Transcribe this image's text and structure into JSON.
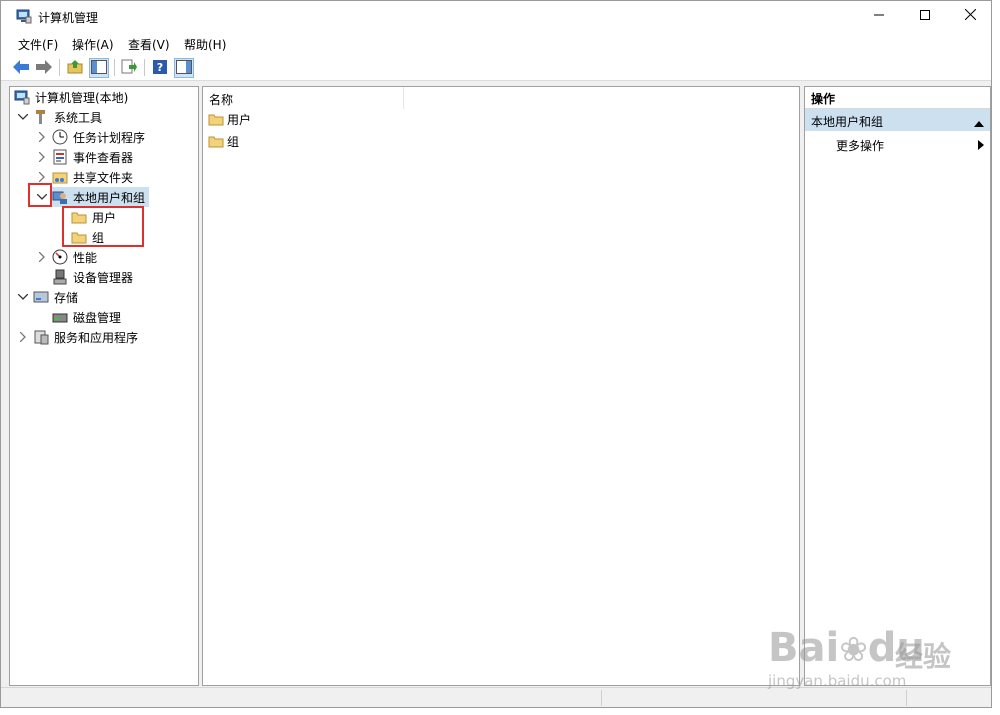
{
  "window": {
    "title": "计算机管理",
    "controls": [
      "minimize",
      "maximize",
      "close"
    ]
  },
  "menu": [
    "文件(F)",
    "操作(A)",
    "查看(V)",
    "帮助(H)"
  ],
  "toolbar": {
    "buttons": [
      "back-icon",
      "forward-icon",
      "up-folder-icon",
      "show-hide-tree-icon",
      "export-list-icon",
      "help-icon",
      "show-hide-action-pane-icon"
    ]
  },
  "tree": {
    "root": "计算机管理(本地)",
    "system_tools": "系统工具",
    "task_scheduler": "任务计划程序",
    "event_viewer": "事件查看器",
    "shared_folders": "共享文件夹",
    "local_users_groups": "本地用户和组",
    "users": "用户",
    "groups": "组",
    "performance": "性能",
    "device_manager": "设备管理器",
    "storage": "存储",
    "disk_management": "磁盘管理",
    "services_apps": "服务和应用程序"
  },
  "list": {
    "column_name": "名称",
    "items": [
      "用户",
      "组"
    ]
  },
  "actions": {
    "header": "操作",
    "section": "本地用户和组",
    "more": "更多操作"
  },
  "watermark": {
    "brand": "Bai",
    "brand2": "du",
    "brand_cn": "经验",
    "url": "jingyan.baidu.com"
  },
  "colors": {
    "selection": "#cde0f0",
    "highlight_box": "#e0302e",
    "folder": "#f4d27a"
  }
}
